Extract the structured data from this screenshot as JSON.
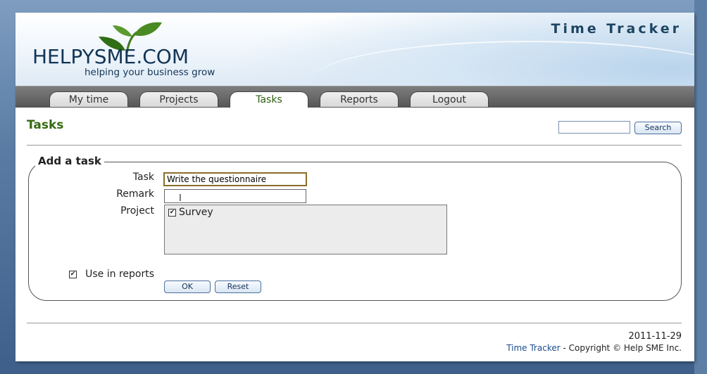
{
  "app": {
    "title": "Time Tracker",
    "logo_text": "HELPYSME.COM",
    "tagline": "helping your business grow"
  },
  "nav": {
    "tabs": [
      {
        "label": "My time",
        "active": false
      },
      {
        "label": "Projects",
        "active": false
      },
      {
        "label": "Tasks",
        "active": true
      },
      {
        "label": "Reports",
        "active": false
      },
      {
        "label": "Logout",
        "active": false
      }
    ]
  },
  "page": {
    "title": "Tasks",
    "search": {
      "value": "",
      "button_label": "Search"
    }
  },
  "form": {
    "legend": "Add a task",
    "task_label": "Task",
    "task_value": "Write the questionnaire",
    "remark_label": "Remark",
    "remark_value": "",
    "project_label": "Project",
    "projects": [
      {
        "label": "Survey",
        "checked": true
      }
    ],
    "use_in_reports_label": "Use in reports",
    "use_in_reports_checked": true,
    "ok_label": "OK",
    "reset_label": "Reset"
  },
  "footer": {
    "date": "2011-11-29",
    "link_text": "Time Tracker",
    "copyright": " - Copyright © Help SME Inc."
  },
  "colors": {
    "accent_green": "#356a10",
    "header_blue": "#1d4561",
    "button_border": "#4a6fa0"
  },
  "icons": {
    "logo": "leaf-logo-icon",
    "text_cursor": "ibeam-cursor-icon",
    "checkbox": "checkbox-icon"
  }
}
